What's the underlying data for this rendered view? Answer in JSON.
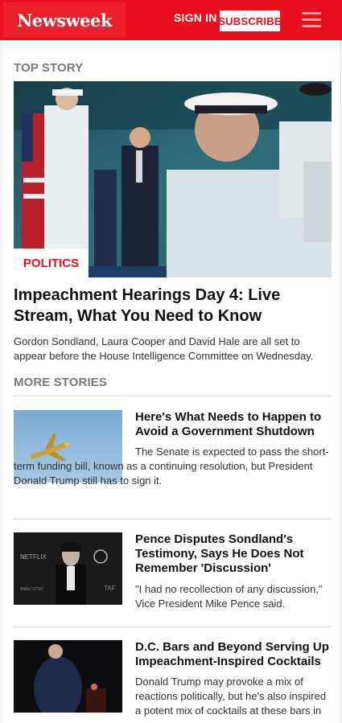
{
  "header": {
    "logo": "Newsweek",
    "signin_label": "SIGN IN",
    "subscribe_label": "SUBSCRIBE",
    "menu_icon": "hamburger-menu-icon",
    "brand_color": "#e8101d"
  },
  "top_story": {
    "section_label": "TOP STORY",
    "category": "POLITICS",
    "headline": "Impeachment Hearings Day 4: Live Stream, What You Need to Know",
    "dek": "Gordon Sondland, Laura Cooper and David Hale are all set to appear before the House Intelligence Committee on Wednesday."
  },
  "more_stories": {
    "section_label": "MORE STORIES",
    "items": [
      {
        "title": "Here's What Needs to Happen to Avoid a Government Shutdown",
        "dek": "The Senate is expected to pass the short-term funding bill, known as a continuing resolution, but President Donald Trump still has to sign it."
      },
      {
        "title": "Pence Disputes Sondland's Testimony, Says He Does Not Remember 'Discussion'",
        "dek": "\"I had no recollection of any discussion,\" Vice President Mike Pence said.",
        "thumb_text_1": "NETFLIX",
        "thumb_text_2": "AMAZ STUD",
        "thumb_text_3": "TAF"
      },
      {
        "title": "D.C. Bars and Beyond Serving Up Impeachment-Inspired Cocktails",
        "dek": "Donald Trump may provoke a mix of reactions politically, but he's also inspired a potent mix of cocktails at these bars in"
      }
    ]
  }
}
